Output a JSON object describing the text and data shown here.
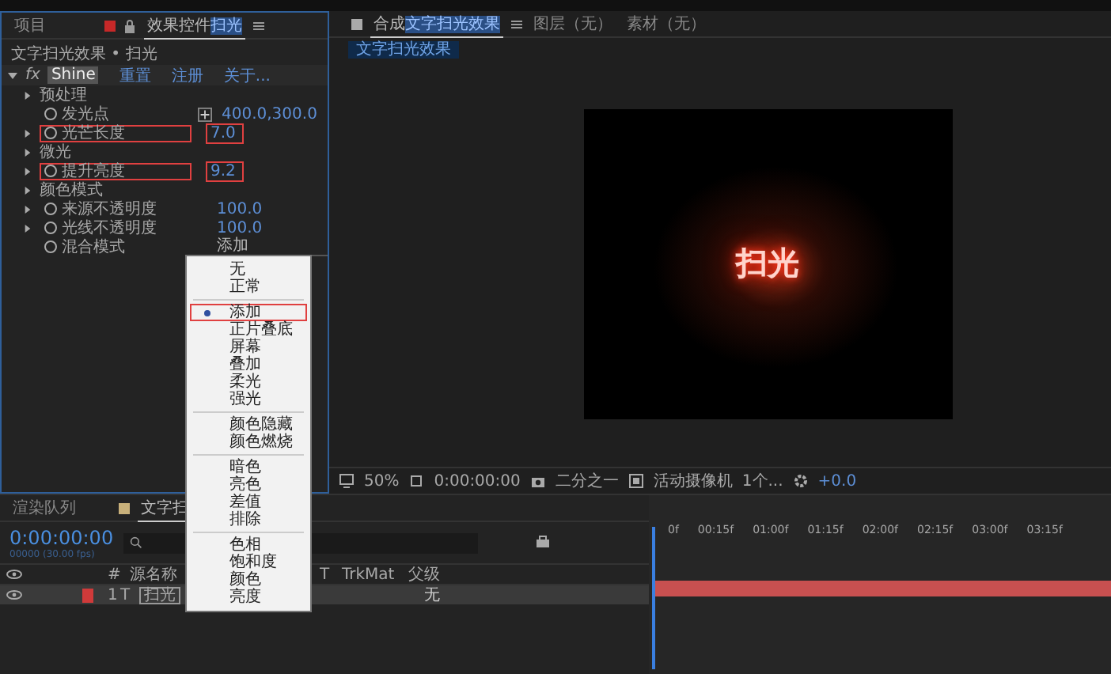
{
  "effects_panel": {
    "tabs": [
      {
        "label": "项目",
        "selected": false
      },
      {
        "label": "效果控件",
        "layer": "扫光",
        "selected": true
      }
    ],
    "breadcrumb": "文字扫光效果 • 扫光",
    "effect": {
      "badge": "fx",
      "name": "Shine",
      "actions": [
        "重置",
        "注册",
        "关于..."
      ]
    },
    "properties": [
      {
        "kind": "group",
        "label": "预处理",
        "annotated": false
      },
      {
        "kind": "point",
        "label": "发光点",
        "value": "400.0,300.0",
        "annotated": false
      },
      {
        "kind": "param",
        "label": "光芒长度",
        "value": "7.0",
        "annotated": true
      },
      {
        "kind": "group",
        "label": "微光",
        "annotated": false
      },
      {
        "kind": "param",
        "label": "提升亮度",
        "value": "9.2",
        "annotated": true
      },
      {
        "kind": "group",
        "label": "颜色模式",
        "annotated": false
      },
      {
        "kind": "param",
        "label": "来源不透明度",
        "value": "100.0",
        "annotated": false
      },
      {
        "kind": "param",
        "label": "光线不透明度",
        "value": "100.0",
        "annotated": false
      },
      {
        "kind": "select",
        "label": "混合模式",
        "value": "添加",
        "annotated": false
      }
    ]
  },
  "blend_menu": [
    [
      {
        "label": "无",
        "selected": false,
        "annotated": false
      },
      {
        "label": "正常",
        "selected": false,
        "annotated": false
      }
    ],
    [
      {
        "label": "添加",
        "selected": true,
        "annotated": true
      },
      {
        "label": "正片叠底",
        "selected": false,
        "annotated": false
      },
      {
        "label": "屏幕",
        "selected": false,
        "annotated": false
      },
      {
        "label": "叠加",
        "selected": false,
        "annotated": false
      },
      {
        "label": "柔光",
        "selected": false,
        "annotated": false
      },
      {
        "label": "强光",
        "selected": false,
        "annotated": false
      }
    ],
    [
      {
        "label": "颜色隐藏",
        "selected": false,
        "annotated": false
      },
      {
        "label": "颜色燃烧",
        "selected": false,
        "annotated": false
      }
    ],
    [
      {
        "label": "暗色",
        "selected": false,
        "annotated": false
      },
      {
        "label": "亮色",
        "selected": false,
        "annotated": false
      },
      {
        "label": "差值",
        "selected": false,
        "annotated": false
      },
      {
        "label": "排除",
        "selected": false,
        "annotated": false
      }
    ],
    [
      {
        "label": "色相",
        "selected": false,
        "annotated": false
      },
      {
        "label": "饱和度",
        "selected": false,
        "annotated": false
      },
      {
        "label": "颜色",
        "selected": false,
        "annotated": false
      },
      {
        "label": "亮度",
        "selected": false,
        "annotated": false
      }
    ]
  ],
  "comp_panel": {
    "tabs": [
      {
        "label": "合成",
        "name": "文字扫光效果",
        "selected": true
      },
      {
        "label": "图层（无）",
        "selected": false
      },
      {
        "label": "素材（无）",
        "selected": false
      }
    ],
    "subtab": "文字扫光效果",
    "preview_text": "扫光",
    "toolbar": {
      "zoom": "50%",
      "time": "0:00:00:00",
      "resolution": "二分之一",
      "camera": "活动摄像机",
      "views": "1个...",
      "exposure": "+0.0"
    }
  },
  "timeline": {
    "tabs": [
      {
        "label": "渲染队列",
        "selected": false
      },
      {
        "label": "文字扫",
        "selected": true
      }
    ],
    "time": "0:00:00:00",
    "frames": "00000 (30.00 fps)",
    "columns": [
      "#",
      "源名称",
      "T",
      "TrkMat",
      "父级"
    ],
    "layers": [
      {
        "number": "1",
        "type": "T",
        "name": "扫光",
        "parent": "无",
        "color": "#d03a3a"
      }
    ],
    "ruler": [
      "0f",
      "00:15f",
      "01:00f",
      "01:15f",
      "02:00f",
      "02:15f",
      "03:00f",
      "03:15f"
    ]
  }
}
